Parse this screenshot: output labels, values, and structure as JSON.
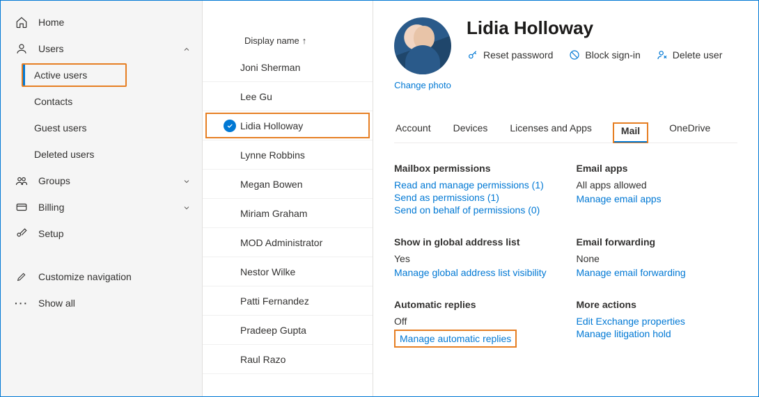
{
  "sidebar": {
    "home": "Home",
    "users": "Users",
    "users_sub": {
      "active": "Active users",
      "contacts": "Contacts",
      "guest": "Guest users",
      "deleted": "Deleted users"
    },
    "groups": "Groups",
    "billing": "Billing",
    "setup": "Setup",
    "customize": "Customize navigation",
    "show_all": "Show all"
  },
  "list": {
    "header": "Display name",
    "users": [
      "Joni Sherman",
      "Lee Gu",
      "Lidia Holloway",
      "Lynne Robbins",
      "Megan Bowen",
      "Miriam Graham",
      "MOD Administrator",
      "Nestor Wilke",
      "Patti Fernandez",
      "Pradeep Gupta",
      "Raul Razo"
    ],
    "selected_index": 2
  },
  "detail": {
    "name": "Lidia Holloway",
    "change_photo": "Change photo",
    "actions": {
      "reset": "Reset password",
      "block": "Block sign-in",
      "delete": "Delete user"
    },
    "tabs": {
      "account": "Account",
      "devices": "Devices",
      "licenses": "Licenses and Apps",
      "mail": "Mail",
      "onedrive": "OneDrive"
    },
    "sections": {
      "mailbox_perm": {
        "title": "Mailbox permissions",
        "link1": "Read and manage permissions (1)",
        "link2": "Send as permissions (1)",
        "link3": "Send on behalf of permissions (0)"
      },
      "email_apps": {
        "title": "Email apps",
        "status": "All apps allowed",
        "link": "Manage email apps"
      },
      "gal": {
        "title": "Show in global address list",
        "status": "Yes",
        "link": "Manage global address list visibility"
      },
      "forwarding": {
        "title": "Email forwarding",
        "status": "None",
        "link": "Manage email forwarding"
      },
      "auto_reply": {
        "title": "Automatic replies",
        "status": "Off",
        "link": "Manage automatic replies"
      },
      "more": {
        "title": "More actions",
        "link1": "Edit Exchange properties",
        "link2": "Manage litigation hold"
      }
    }
  }
}
